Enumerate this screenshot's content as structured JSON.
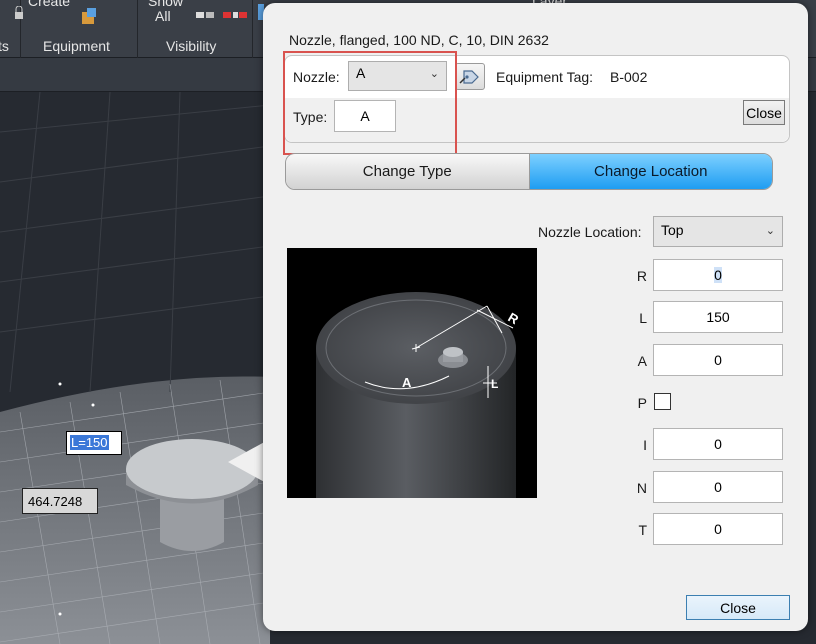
{
  "ribbon": {
    "top_left_text": "Create",
    "show_label": "Show",
    "show_all": "All",
    "groups": [
      "ts",
      "Equipment",
      "Visibility"
    ],
    "layer_label": "Layer"
  },
  "viewport": {
    "dim_L": "L=150",
    "dim_value": "464.7248"
  },
  "dialog": {
    "title": "Nozzle, flanged, 100 ND, C, 10, DIN 2632",
    "nozzle_label": "Nozzle:",
    "nozzle_value": "A",
    "type_label": "Type:",
    "type_value": "A",
    "equipment_tag_label": "Equipment Tag:",
    "equipment_tag_value": "B-002",
    "close_top": "Close",
    "tabs": [
      "Change Type",
      "Change Location"
    ],
    "active_tab": "Change Location",
    "nozzle_location_label": "Nozzle Location:",
    "nozzle_location_value": "Top",
    "fields": [
      {
        "label": "R",
        "value": "0"
      },
      {
        "label": "L",
        "value": "150"
      },
      {
        "label": "A",
        "value": "0"
      },
      {
        "label": "I",
        "value": "0"
      },
      {
        "label": "N",
        "value": "0"
      },
      {
        "label": "T",
        "value": "0"
      }
    ],
    "p_label": "P",
    "p_checked": false,
    "preview_labels": {
      "R": "R",
      "A": "A",
      "L": "L"
    },
    "close_bottom": "Close"
  },
  "colors": {
    "highlight": "#d9534f",
    "active_tab": "#1e9df2",
    "selected_text": "#3b78d8"
  }
}
